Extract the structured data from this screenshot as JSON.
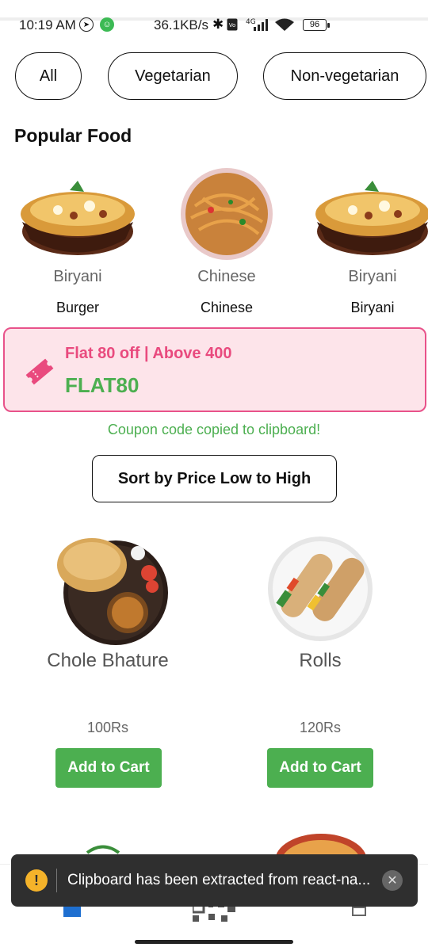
{
  "status_bar": {
    "time": "10:19 AM",
    "speed": "36.1KB/s",
    "network": "4G",
    "battery": "96"
  },
  "filters": [
    "All",
    "Vegetarian",
    "Non-vegetarian"
  ],
  "popular": {
    "title": "Popular Food",
    "items": [
      {
        "name": "Biryani",
        "sub": "Burger",
        "icon": "biryani-image"
      },
      {
        "name": "Chinese",
        "sub": "Chinese",
        "icon": "noodles-image"
      },
      {
        "name": "Biryani",
        "sub": "Biryani",
        "icon": "biryani-image"
      }
    ]
  },
  "coupon": {
    "title": "Flat 80 off | Above 400",
    "code": "FLAT80",
    "copied_message": "Coupon code copied to clipboard!",
    "icon": "ticket-icon"
  },
  "sort_button": "Sort by Price Low to High",
  "products": [
    {
      "name": "Chole Bhature",
      "price": "100Rs",
      "button": "Add to Cart"
    },
    {
      "name": "Rolls",
      "price": "120Rs",
      "button": "Add to Cart"
    }
  ],
  "toast": {
    "message": "Clipboard has been extracted from react-na...",
    "icon": "warning-icon"
  },
  "colors": {
    "accent_green": "#4caf50",
    "coupon_pink": "#e94a7e",
    "coupon_bg": "#fde4ea"
  }
}
